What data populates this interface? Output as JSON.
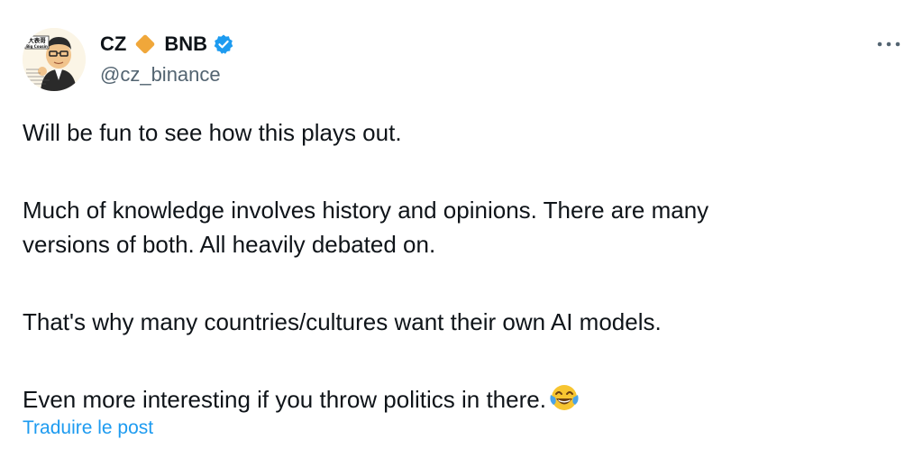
{
  "author": {
    "name_left": "CZ",
    "name_right": "BNB",
    "handle": "@cz_binance",
    "avatar_label_top": "大表哥",
    "avatar_label_sub": "Big Cousin",
    "verified": true,
    "diamond_color": "#f0a73a",
    "verified_color": "#1d9bf0",
    "icons": [
      "diamond-icon",
      "verified-icon",
      "more-icon"
    ]
  },
  "tweet": {
    "line1": "Will be fun to see how this plays out.",
    "line2": "Much of knowledge involves history and opinions. There are many",
    "line3": "versions of both. All heavily debated on.",
    "line4": "That's why many countries/cultures want their own AI models.",
    "line5": "Even more interesting if you throw politics in there.",
    "emoji": "tears-of-joy-emoji"
  },
  "actions": {
    "translate_label": "Traduire le post"
  }
}
